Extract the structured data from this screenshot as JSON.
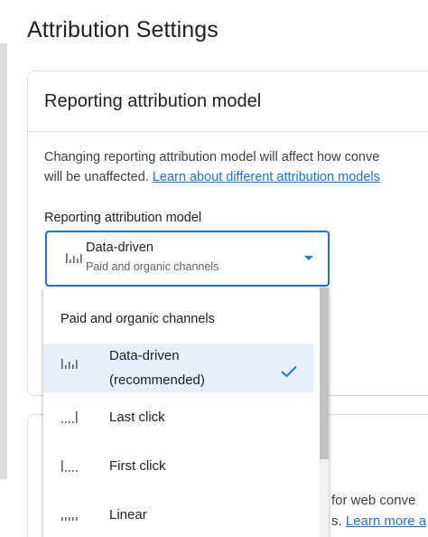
{
  "page": {
    "title": "Attribution Settings"
  },
  "card": {
    "title": "Reporting attribution model",
    "description_line1": "Changing reporting attribution model will affect how conve",
    "description_line2_prefix": "will be unaffected. ",
    "learn_link": "Learn about different attribution models",
    "field_label": "Reporting attribution model"
  },
  "select": {
    "value": "Data-driven",
    "subtext": "Paid and organic channels",
    "icon": "data-driven-bars-icon",
    "accent_color": "#1a73e8"
  },
  "dropdown": {
    "group_header": "Paid and organic channels",
    "items": [
      {
        "label": "Data-driven",
        "label_extra": "(recommended)",
        "icon": "data-driven-bars-icon",
        "selected": true
      },
      {
        "label": "Last click",
        "icon": "last-click-bars-icon",
        "selected": false
      },
      {
        "label": "First click",
        "icon": "first-click-bars-icon",
        "selected": false
      },
      {
        "label": "Linear",
        "icon": "linear-bars-icon",
        "selected": false
      }
    ],
    "selected_bg": "#e8f0fe"
  },
  "card2": {
    "text_line1": "for web conve",
    "text_line2_prefix": "s. ",
    "learn_link": "Learn more a"
  }
}
